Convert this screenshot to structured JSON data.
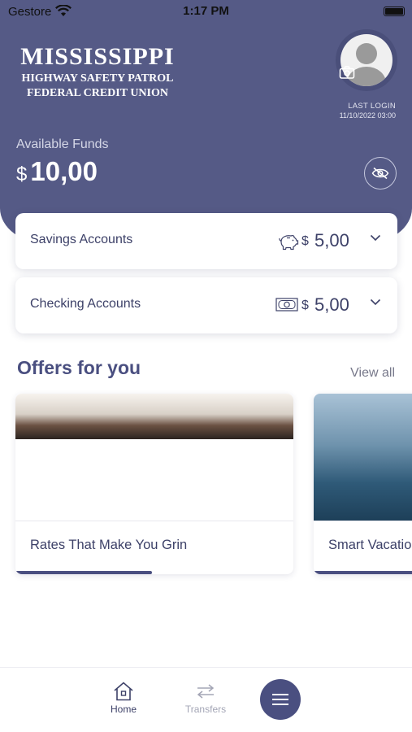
{
  "status_bar": {
    "carrier": "Gestore",
    "time": "1:17 PM"
  },
  "header": {
    "logo": {
      "line1": "MISSISSIPPI",
      "line2": "HIGHWAY SAFETY PATROL",
      "line3": "FEDERAL CREDIT UNION"
    },
    "last_login_label": "LAST LOGIN",
    "last_login_date": "11/10/2022 03:00",
    "funds_label": "Available Funds",
    "funds_currency": "$",
    "funds_value": "10,00"
  },
  "accounts": [
    {
      "name": "Savings Accounts",
      "icon": "piggy-bank-icon",
      "currency": "$",
      "amount": "5,00"
    },
    {
      "name": "Checking Accounts",
      "icon": "banknote-icon",
      "currency": "$",
      "amount": "5,00"
    }
  ],
  "offers": {
    "title": "Offers for you",
    "view_all": "View all",
    "items": [
      {
        "label": "Rates That Make You Grin",
        "progress": 0.49
      },
      {
        "label": "Smart Vacations",
        "progress": 1.0
      }
    ]
  },
  "tab_bar": {
    "tabs": [
      {
        "label": "Home",
        "icon": "home-icon",
        "active": true
      },
      {
        "label": "Transfers",
        "icon": "transfer-arrows-icon",
        "active": false
      }
    ],
    "menu_icon": "hamburger-menu-icon"
  },
  "colors": {
    "brand": "#555a86",
    "accent": "#4a4f80",
    "text": "#3d4168"
  }
}
